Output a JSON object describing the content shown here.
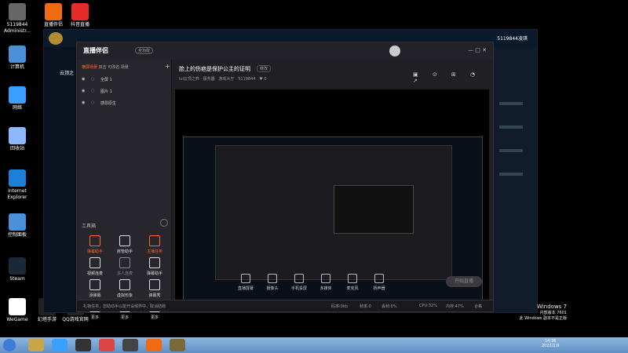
{
  "desktop": {
    "icons_left": [
      {
        "label": "5119844 Administr...",
        "color": "#666"
      },
      {
        "label": "计算机",
        "color": "#4a90d9"
      },
      {
        "label": "网络",
        "color": "#3aa0ff"
      },
      {
        "label": "回收站",
        "color": "#8db7ff"
      },
      {
        "label": "Internet Explorer",
        "color": "#1e7fd6"
      },
      {
        "label": "控制面板",
        "color": "#4a90d9"
      },
      {
        "label": "Steam",
        "color": "#1b2838"
      },
      {
        "label": "WeGame",
        "color": "#fff"
      }
    ],
    "icons_top": [
      {
        "label": "直播伴侣",
        "color": "#f26a0f"
      },
      {
        "label": "抖音直播",
        "color": "#e62b2b"
      }
    ],
    "icons_bottom": [
      {
        "label": "幻塔手游"
      },
      {
        "label": "QQ游戏官网"
      }
    ]
  },
  "game": {
    "title_right": "5119844凌琪",
    "side_text": "云顶之"
  },
  "app": {
    "name": "直播伴侣",
    "tag": "全功能",
    "scene_tabs": [
      "横屏场景",
      "双击",
      "可改名",
      "场景"
    ],
    "sources": [
      {
        "label": "全屏 1"
      },
      {
        "label": "图片 1"
      },
      {
        "label": "感恩原生"
      }
    ],
    "toolbox_label": "工具箱",
    "tools": [
      {
        "label": "弹幕助手",
        "color": "#ff6a2a"
      },
      {
        "label": "房管助手",
        "color": "#ddd"
      },
      {
        "label": "主播任务",
        "color": "#ff6a2a"
      },
      {
        "label": "视频连麦",
        "color": "#ddd"
      },
      {
        "label": "多人连麦",
        "color": "#888"
      },
      {
        "label": "弹幕助手",
        "color": "#ddd"
      },
      {
        "label": "添弹幕",
        "color": "#ddd"
      },
      {
        "label": "虚拟形象",
        "color": "#ddd"
      },
      {
        "label": "弹幕秀",
        "color": "#ddd"
      },
      {
        "label": "更多",
        "color": "#ddd"
      },
      {
        "label": "更多",
        "color": "#ddd"
      },
      {
        "label": "更多",
        "color": "#ddd"
      }
    ],
    "stream_title": "脸上的伤疤是保护公主的证明",
    "edit_label": "修改",
    "stream_meta_1": "lol云顶之弈 · 服务器",
    "stream_meta_2": "游戏大厅",
    "stream_meta_3": "5119844",
    "likes": "0",
    "bottom_tools": [
      {
        "label": "直播屏幕"
      },
      {
        "label": "摄像头"
      },
      {
        "label": "手机投屏"
      },
      {
        "label": "多媒体"
      },
      {
        "label": "麦克风"
      },
      {
        "label": "扬声器"
      }
    ],
    "start_button": "开始直播",
    "status": {
      "notice": "礼物任务，您助动手以能开设候界中，取消助跨",
      "bitrate": "码率:0kb",
      "cpu": "CPU:32%",
      "fps": "帧率:0",
      "loss": "丢帧:0%",
      "mem": "内存:47%",
      "net": "合格"
    }
  },
  "taskbar": {
    "time": "14:36",
    "date": "2022/1/9",
    "windows_text_1": "Windows 7",
    "windows_text_2": "内部版本 7601",
    "windows_text_3": "此 Windows 副本不是正版"
  }
}
